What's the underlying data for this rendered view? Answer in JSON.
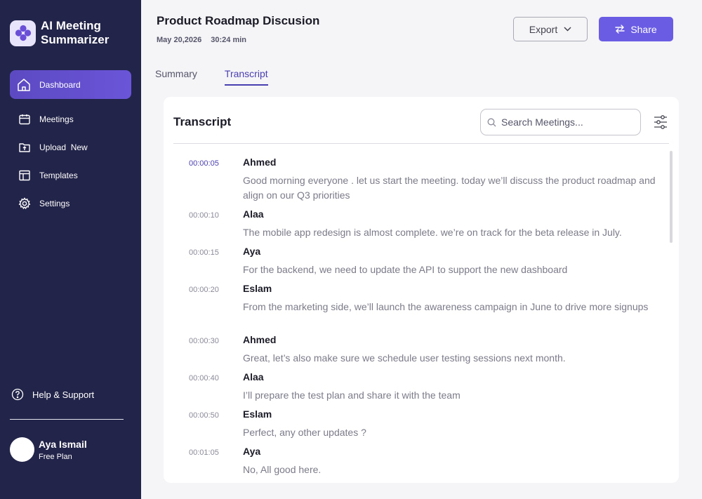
{
  "brand": {
    "name_line1": "AI Meeting",
    "name_line2": "Summarizer"
  },
  "sidebar": {
    "items": [
      {
        "label": "Dashboard",
        "icon": "home-icon",
        "active": true
      },
      {
        "label": "Meetings",
        "icon": "calendar-icon"
      },
      {
        "label": "Upload  New",
        "icon": "upload-icon"
      },
      {
        "label": "Templates",
        "icon": "templates-icon"
      },
      {
        "label": "Settings",
        "icon": "gear-icon"
      }
    ],
    "help": {
      "label": "Help & Support",
      "icon": "help-icon"
    }
  },
  "user": {
    "name": "Aya Ismail",
    "plan": "Free Plan"
  },
  "header": {
    "title": "Product Roadmap Discusion",
    "date": "May 20,2026",
    "duration": "30:24 min",
    "export_label": "Export",
    "share_label": "Share"
  },
  "tabs": [
    {
      "label": "Summary",
      "active": false
    },
    {
      "label": "Transcript",
      "active": true
    }
  ],
  "transcript": {
    "title": "Transcript",
    "search_placeholder": "Search Meetings...",
    "entries": [
      {
        "time": "00:00:05",
        "speaker": "Ahmed",
        "text": "Good morning everyone . let us start the meeting. today we’ll discuss the product roadmap and align on our Q3 priorities",
        "active": true
      },
      {
        "time": "00:00:10",
        "speaker": "Alaa",
        "text": "The mobile app redesign is almost complete. we’re on track for the beta release in July."
      },
      {
        "time": "00:00:15",
        "speaker": "Aya",
        "text": "For the backend, we need to update the API to support the new dashboard"
      },
      {
        "time": "00:00:20",
        "speaker": "Eslam",
        "text": "From the marketing side, we’ll launch the awareness campaign in June to drive more signups"
      },
      {
        "time": "00:00:30",
        "speaker": "Ahmed",
        "text": "Great, let’s also make sure we schedule user testing sessions next month."
      },
      {
        "time": "00:00:40",
        "speaker": "Alaa",
        "text": "I’ll prepare the test plan and share it with the team"
      },
      {
        "time": "00:00:50",
        "speaker": "Eslam",
        "text": "Perfect, any other updates ?"
      },
      {
        "time": "00:01:05",
        "speaker": "Aya",
        "text": "No, All good here."
      }
    ]
  },
  "colors": {
    "sidebar": "#23244a",
    "accent": "#6a5de3",
    "active_tab": "#4a3fb0"
  }
}
